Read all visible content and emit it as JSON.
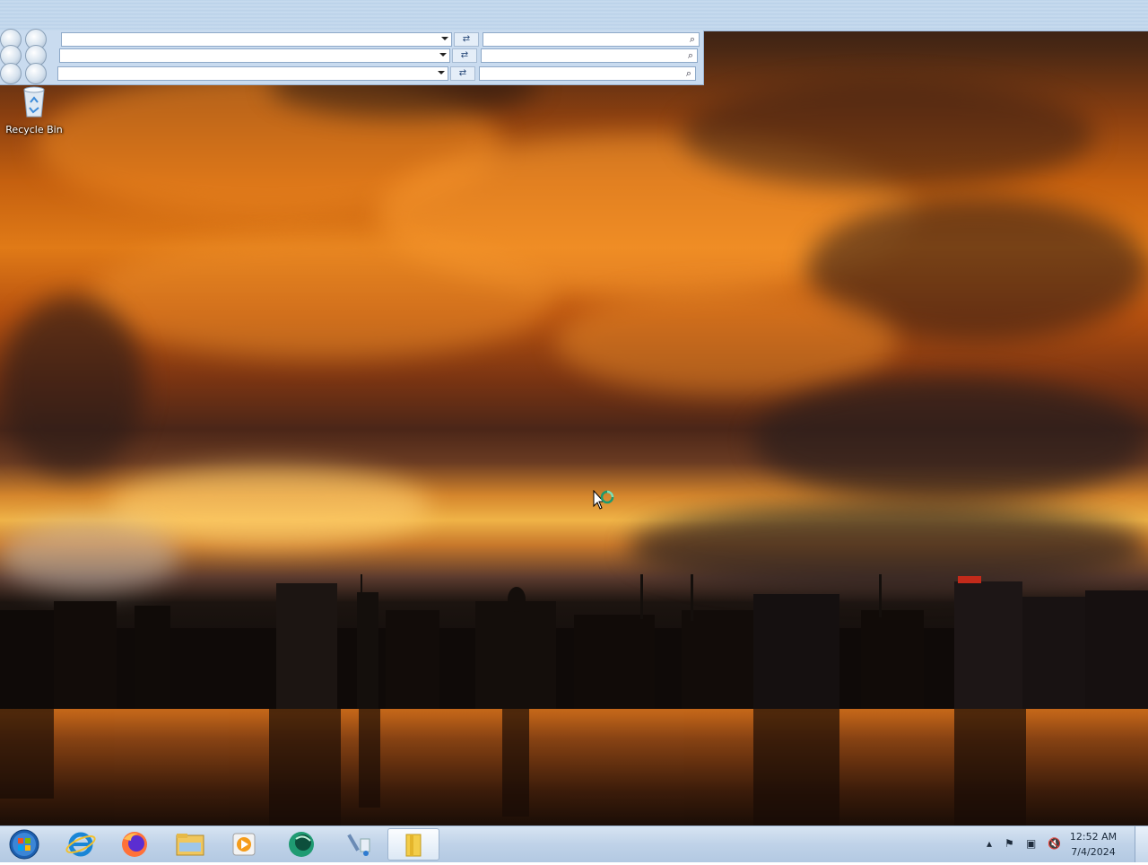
{
  "desktop": {
    "icons": [
      {
        "label": "Recycle Bin",
        "icon": "recycle-bin-icon"
      }
    ]
  },
  "toolbars": {
    "rows": [
      {
        "address_value": "",
        "search_value": ""
      },
      {
        "address_value": "",
        "search_value": ""
      },
      {
        "address_value": "",
        "search_value": ""
      }
    ]
  },
  "taskbar": {
    "start_icon": "windows-start-orb",
    "pinned": [
      {
        "icon": "internet-explorer-icon"
      },
      {
        "icon": "firefox-icon"
      },
      {
        "icon": "file-explorer-icon"
      },
      {
        "icon": "media-player-icon"
      },
      {
        "icon": "green-globe-app-icon"
      },
      {
        "icon": "paint-tools-icon"
      },
      {
        "icon": "yellow-folder-window-icon",
        "active": true
      }
    ],
    "tray": {
      "icons": [
        "tray-expand-icon",
        "action-center-flag-icon",
        "network-icon",
        "volume-muted-icon"
      ],
      "time": "12:52 AM",
      "date": "7/4/2024"
    }
  },
  "colors": {
    "taskbar": "#bfd2e8",
    "toolbar": "#c9dbef",
    "sky_orange": "#e07a17"
  }
}
